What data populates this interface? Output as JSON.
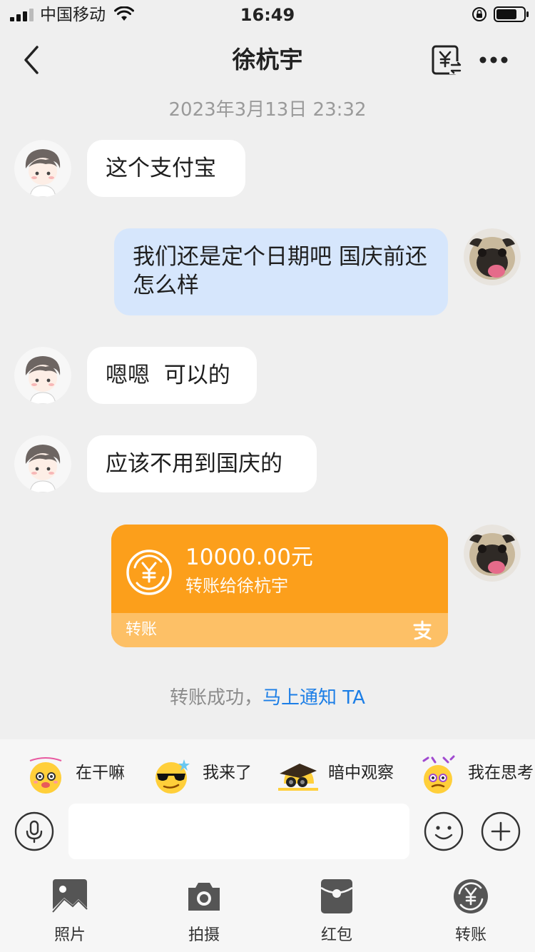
{
  "status_bar": {
    "carrier": "中国移动",
    "time": "16:49"
  },
  "nav": {
    "title": "徐杭宇"
  },
  "chat": {
    "timestamp": "2023年3月13日 23:32",
    "messages": [
      {
        "side": "left",
        "text": "这个支付宝"
      },
      {
        "side": "right",
        "text": "我们还是定个日期吧 国庆前还怎么样"
      },
      {
        "side": "left",
        "text": "嗯嗯  可以的"
      },
      {
        "side": "left",
        "text": "应该不用到国庆的"
      }
    ],
    "transfer": {
      "amount": "10000.00元",
      "description": "转账给徐杭宇",
      "label": "转账"
    },
    "system_message": {
      "text": "转账成功，",
      "link": "马上通知 TA"
    }
  },
  "quick_replies": [
    {
      "label": "在干嘛",
      "icon": "emoji-what-icon"
    },
    {
      "label": "我来了",
      "icon": "emoji-sunglasses-icon"
    },
    {
      "label": "暗中观察",
      "icon": "emoji-observe-icon"
    },
    {
      "label": "我在思考",
      "icon": "emoji-thinking-icon"
    }
  ],
  "input": {
    "value": ""
  },
  "toolbar": [
    {
      "label": "照片",
      "icon": "photo-icon"
    },
    {
      "label": "拍摄",
      "icon": "camera-icon"
    },
    {
      "label": "红包",
      "icon": "red-packet-icon"
    },
    {
      "label": "转账",
      "icon": "transfer-icon"
    }
  ],
  "colors": {
    "background": "#efefef",
    "bubble_left": "#ffffff",
    "bubble_right": "#d6e6fc",
    "transfer_card": "#fc9f1b",
    "link": "#1c7ee6"
  }
}
